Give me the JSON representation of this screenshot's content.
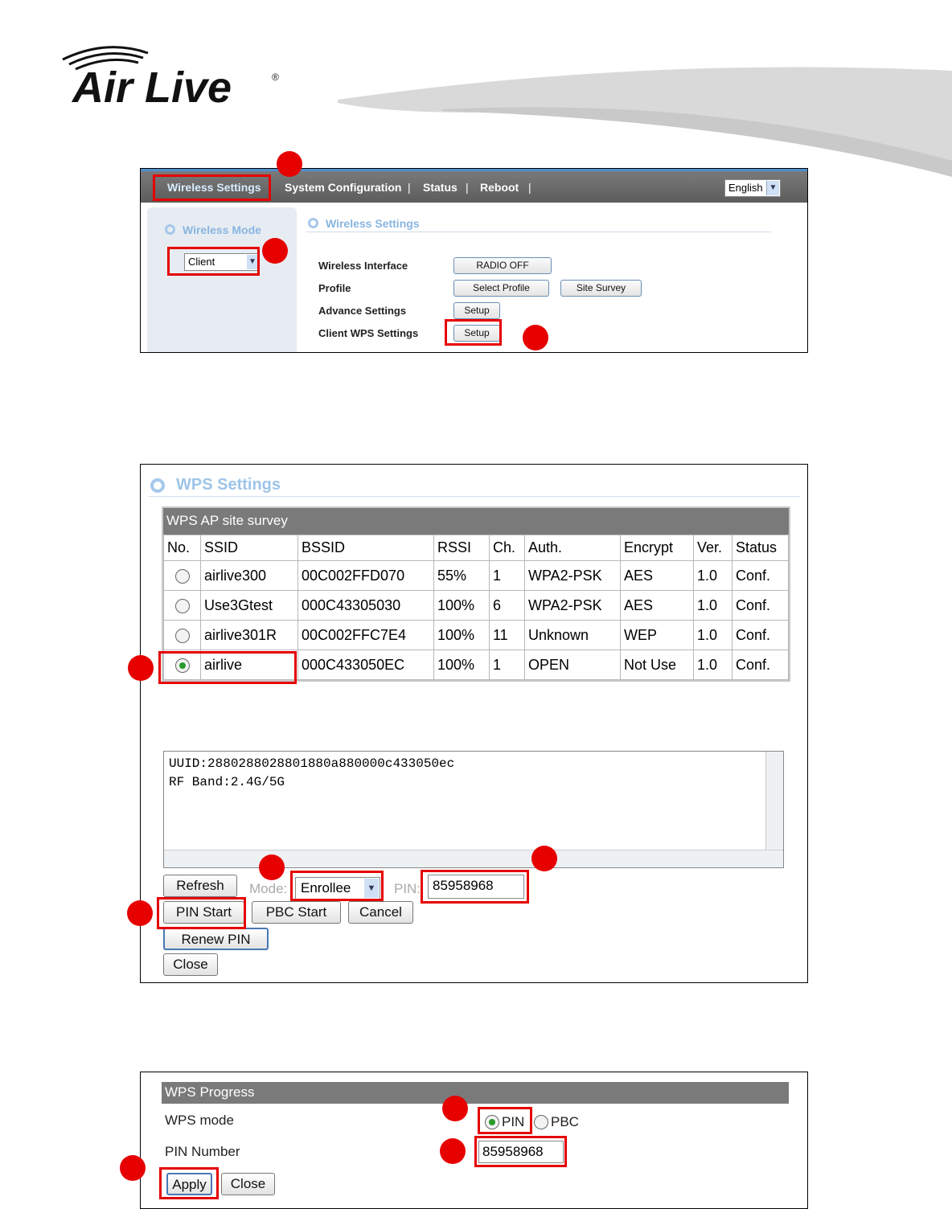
{
  "brand": {
    "logo_text": "Air Live"
  },
  "top_nav": {
    "items": [
      "Wireless Settings",
      "System Configuration",
      "Status",
      "Reboot"
    ],
    "separator": "|",
    "language": "English"
  },
  "sidebar": {
    "title": "Wireless Mode",
    "mode_value": "Client"
  },
  "wireless_settings": {
    "title": "Wireless Settings",
    "rows": [
      {
        "label": "Wireless Interface",
        "buttons": [
          "RADIO OFF"
        ]
      },
      {
        "label": "Profile",
        "buttons": [
          "Select Profile",
          "Site Survey"
        ]
      },
      {
        "label": "Advance Settings",
        "buttons": [
          "Setup"
        ]
      },
      {
        "label": "Client WPS Settings",
        "buttons": [
          "Setup"
        ]
      }
    ]
  },
  "wps_settings": {
    "title": "WPS Settings",
    "survey_title": "WPS AP site survey",
    "columns": [
      "No.",
      "SSID",
      "BSSID",
      "RSSI",
      "Ch.",
      "Auth.",
      "Encrypt",
      "Ver.",
      "Status"
    ],
    "rows": [
      {
        "selected": false,
        "ssid": "airlive300",
        "bssid": "00C002FFD070",
        "rssi": "55%",
        "ch": "1",
        "auth": "WPA2-PSK",
        "encrypt": "AES",
        "ver": "1.0",
        "status": "Conf."
      },
      {
        "selected": false,
        "ssid": "Use3Gtest",
        "bssid": "000C43305030",
        "rssi": "100%",
        "ch": "6",
        "auth": "WPA2-PSK",
        "encrypt": "AES",
        "ver": "1.0",
        "status": "Conf."
      },
      {
        "selected": false,
        "ssid": "airlive301R",
        "bssid": "00C002FFC7E4",
        "rssi": "100%",
        "ch": "11",
        "auth": "Unknown",
        "encrypt": "WEP",
        "ver": "1.0",
        "status": "Conf."
      },
      {
        "selected": true,
        "ssid": "airlive",
        "bssid": "000C433050EC",
        "rssi": "100%",
        "ch": "1",
        "auth": "OPEN",
        "encrypt": "Not Use",
        "ver": "1.0",
        "status": "Conf."
      }
    ],
    "info_lines": [
      "UUID:2880288028801880a880000c433050ec",
      "RF Band:2.4G/5G"
    ],
    "refresh_label": "Refresh",
    "mode_label": "Mode:",
    "mode_value": "Enrollee",
    "pin_label": "PIN:",
    "pin_value": "85958968",
    "pin_start_label": "PIN Start",
    "pbc_start_label": "PBC Start",
    "cancel_label": "Cancel",
    "renew_pin_label": "Renew PIN",
    "close_label": "Close"
  },
  "wps_progress": {
    "title": "WPS Progress",
    "mode_label": "WPS mode",
    "mode_options": [
      "PIN",
      "PBC"
    ],
    "mode_selected": "PIN",
    "pin_label": "PIN Number",
    "pin_value": "85958968",
    "apply_label": "Apply",
    "close_label": "Close"
  },
  "colors": {
    "annotation": "#e60000",
    "nav_bar": "#6a6a6a",
    "accent_blue": "#88b5e0"
  }
}
